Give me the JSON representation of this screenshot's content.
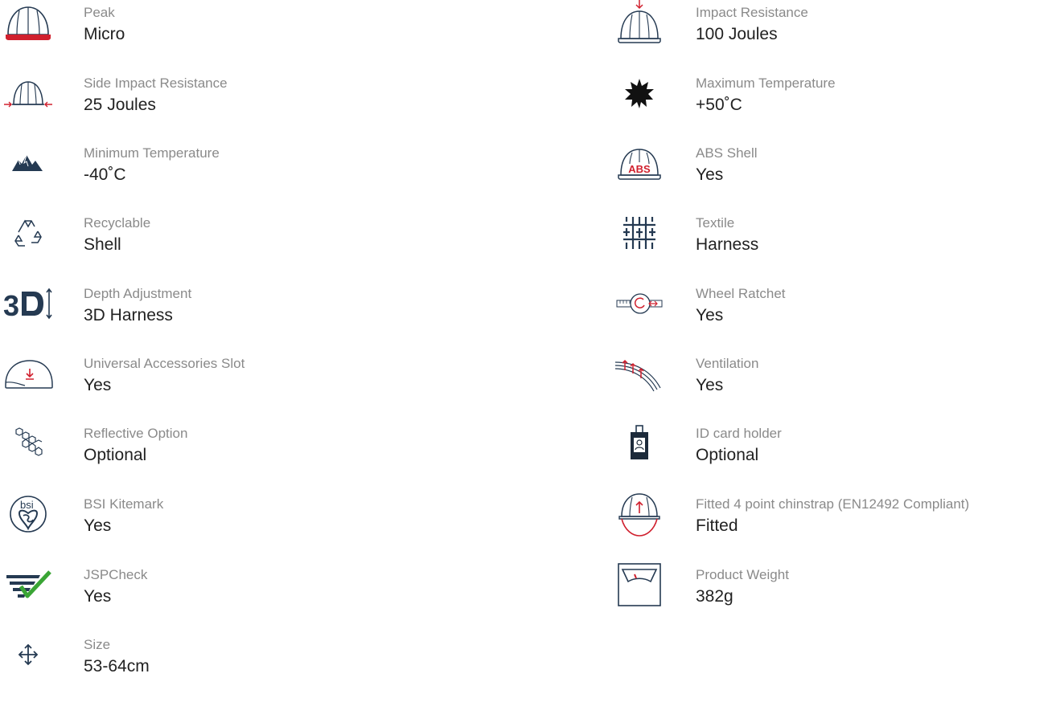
{
  "colors": {
    "navy": "#253a52",
    "red": "#d0202e",
    "label": "#8a8a8a",
    "value": "#222222",
    "green": "#3aa535"
  },
  "left_specs": [
    {
      "icon": "helmet-peak-icon",
      "label": "Peak",
      "value": "Micro"
    },
    {
      "icon": "side-impact-icon",
      "label": "Side Impact Resistance",
      "value": "25 Joules"
    },
    {
      "icon": "mountains-icon",
      "label": "Minimum Temperature",
      "value": "-40˚C"
    },
    {
      "icon": "recycle-icon",
      "label": "Recyclable",
      "value": "Shell"
    },
    {
      "icon": "3d-depth-icon",
      "label": "Depth Adjustment",
      "value": "3D Harness"
    },
    {
      "icon": "accessory-slot-icon",
      "label": "Universal Accessories Slot",
      "value": "Yes"
    },
    {
      "icon": "hexagons-icon",
      "label": "Reflective Option",
      "value": "Optional"
    },
    {
      "icon": "bsi-kitemark-icon",
      "label": "BSI Kitemark",
      "value": "Yes"
    },
    {
      "icon": "jspcheck-icon",
      "label": "JSPCheck",
      "value": "Yes"
    },
    {
      "icon": "size-arrows-icon",
      "label": "Size",
      "value": "53-64cm"
    }
  ],
  "right_specs": [
    {
      "icon": "impact-resistance-icon",
      "label": "Impact Resistance",
      "value": "100 Joules"
    },
    {
      "icon": "sun-icon",
      "label": "Maximum Temperature",
      "value": "+50˚C"
    },
    {
      "icon": "abs-shell-icon",
      "label": "ABS Shell",
      "value": "Yes",
      "icon_text": "ABS"
    },
    {
      "icon": "textile-icon",
      "label": "Textile",
      "value": "Harness"
    },
    {
      "icon": "wheel-ratchet-icon",
      "label": "Wheel Ratchet",
      "value": "Yes"
    },
    {
      "icon": "ventilation-icon",
      "label": "Ventilation",
      "value": "Yes"
    },
    {
      "icon": "id-card-icon",
      "label": "ID card holder",
      "value": "Optional"
    },
    {
      "icon": "chinstrap-icon",
      "label": "Fitted 4 point chinstrap (EN12492 Compliant)",
      "value": "Fitted"
    },
    {
      "icon": "scale-icon",
      "label": "Product Weight",
      "value": "382g"
    }
  ],
  "bsi_text": "bsi"
}
